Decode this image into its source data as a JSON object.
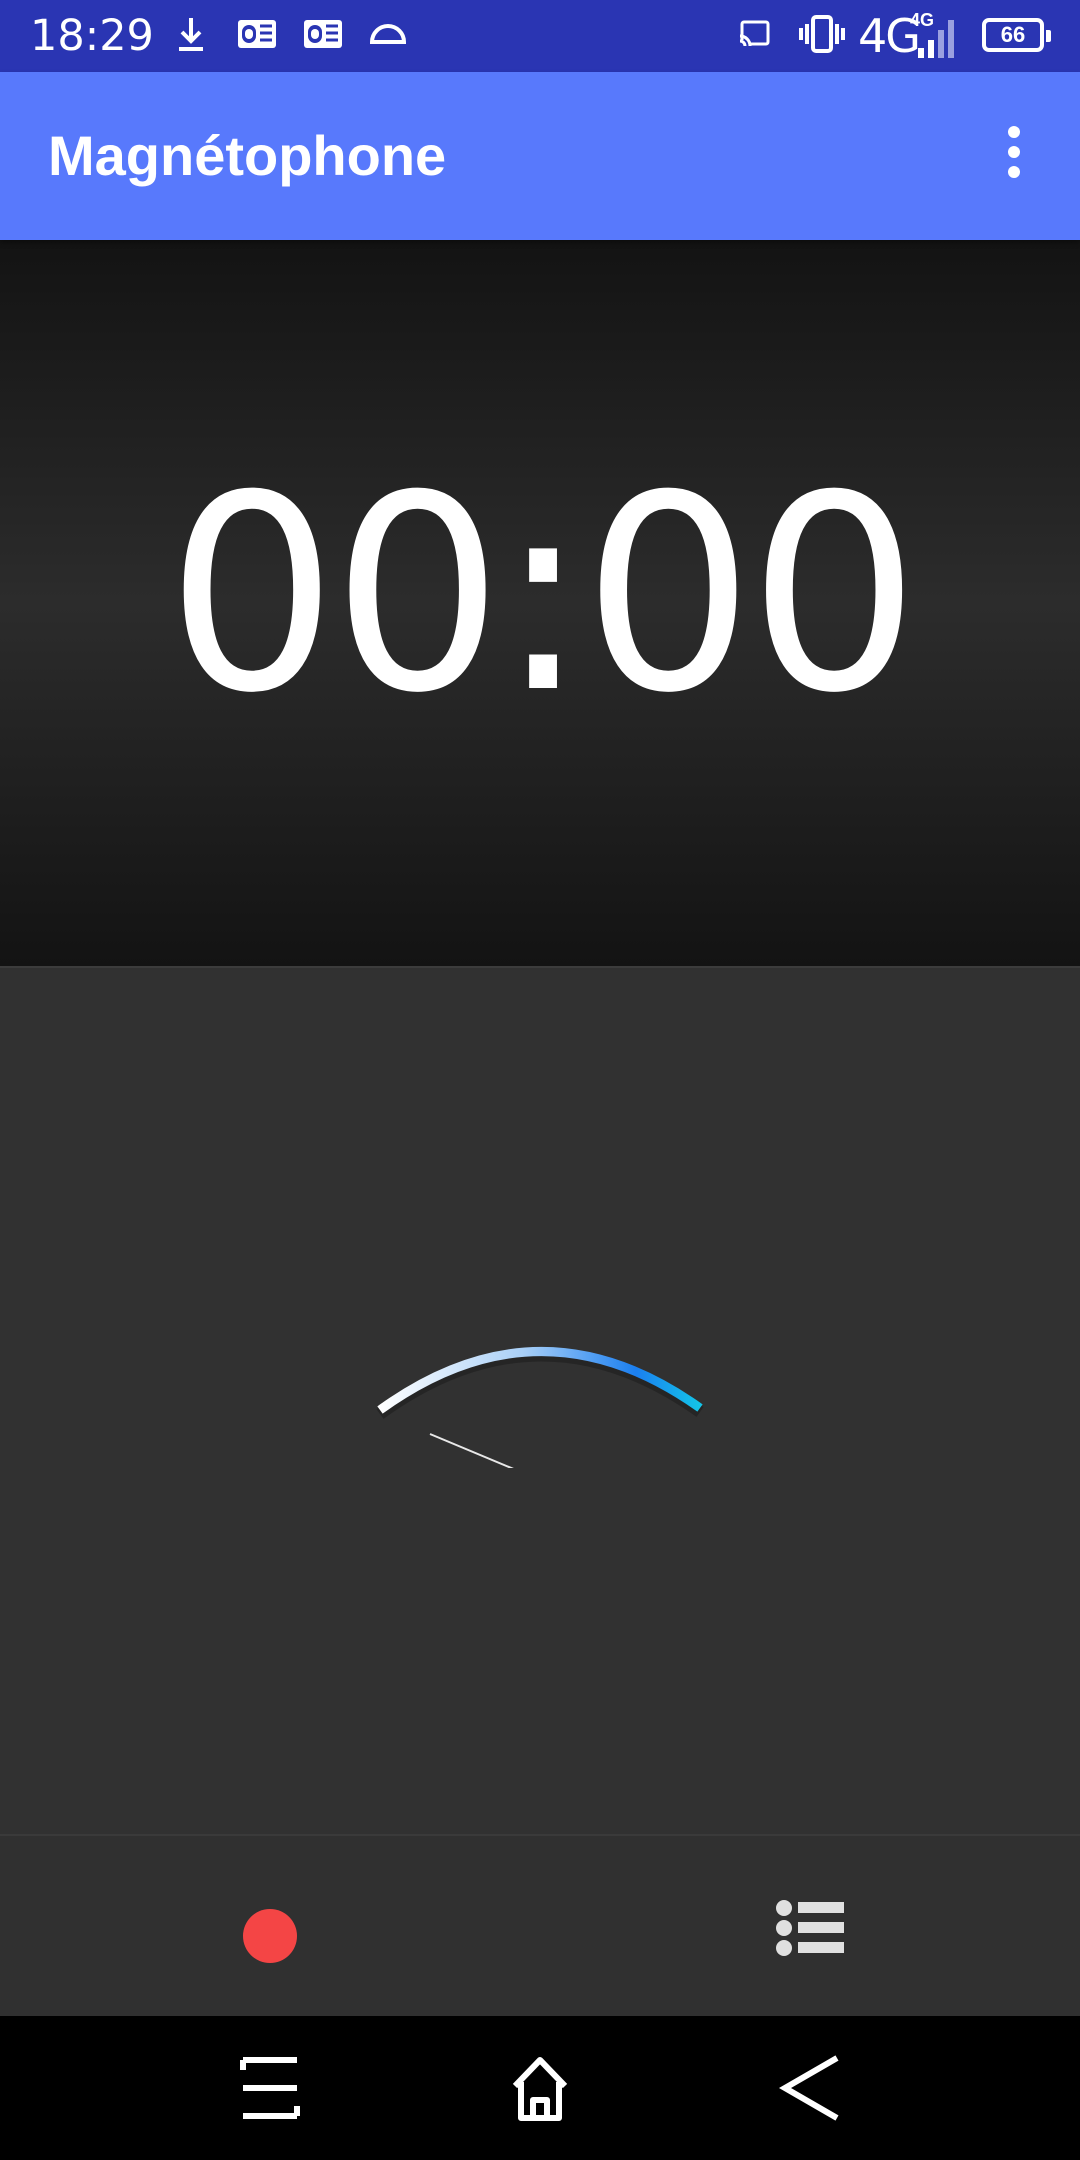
{
  "status_bar": {
    "time": "18:29",
    "network": "4G",
    "network_small": "4G",
    "battery": "66",
    "icons": [
      "download-icon",
      "outlook-icon",
      "outlook-icon",
      "half-circle-icon",
      "cast-icon",
      "vibrate-icon",
      "signal-icon",
      "battery-icon"
    ]
  },
  "app_bar": {
    "title": "Magnétophone",
    "menu_icon": "overflow-menu-icon"
  },
  "timer": {
    "display": "00:00"
  },
  "meter": {
    "type": "level-gauge",
    "arc_colors": [
      "#ffffff",
      "#8fc2f5",
      "#1b7ff0",
      "#13c4e8"
    ]
  },
  "controls": {
    "record_icon": "record-icon",
    "record_color": "#f44545",
    "list_icon": "recordings-list-icon"
  },
  "nav_bar": {
    "icons": [
      "recent-apps-icon",
      "home-icon",
      "back-icon"
    ]
  }
}
